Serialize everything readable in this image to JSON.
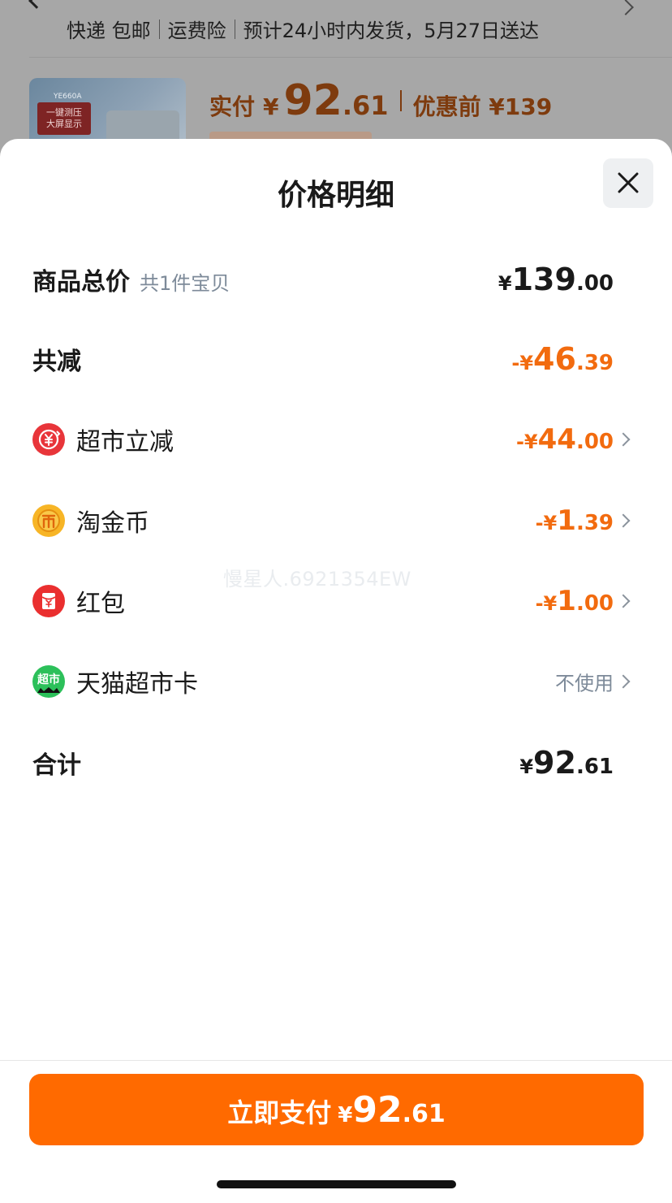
{
  "background": {
    "shipping": [
      "快递 包邮",
      "运费险",
      "预计24小时内发货，5月27日送达"
    ],
    "thumb_code": "YE660A",
    "thumb_badge": "一键测压 大屏显示",
    "paid_label": "实付",
    "paid_yen": "¥",
    "paid_int": "92",
    "paid_dec": ".61",
    "before_label": "优惠前 ¥139"
  },
  "sheet": {
    "title": "价格明细",
    "rows": [
      {
        "label": "商品总价",
        "sub": "共1件宝贝",
        "prefix": "¥",
        "int": "139",
        "dec": ".00"
      },
      {
        "label": "共减",
        "prefix": "-¥",
        "int": "46",
        "dec": ".39"
      },
      {
        "label": "超市立减",
        "icon": "yen-coupon-icon",
        "prefix": "-¥",
        "int": "44",
        "dec": ".00"
      },
      {
        "label": "淘金币",
        "icon": "gold-coin-icon",
        "prefix": "-¥",
        "int": "1",
        "dec": ".39"
      },
      {
        "label": "红包",
        "icon": "red-packet-icon",
        "prefix": "-¥",
        "int": "1",
        "dec": ".00"
      },
      {
        "label": "天猫超市卡",
        "icon": "tmall-supermarket-card-icon",
        "icon_text": "超市",
        "status": "不使用"
      },
      {
        "label": "合计",
        "prefix": "¥",
        "int": "92",
        "dec": ".61"
      }
    ],
    "watermark": "慢星人.6921354EW"
  },
  "footer": {
    "pay_label": "立即支付",
    "pay_yen": "¥",
    "pay_int": "92",
    "pay_dec": ".61"
  },
  "colors": {
    "accent": "#ff6a00",
    "discount": "#f26b0f",
    "text": "#1a1a1a",
    "muted": "#7d8a99"
  }
}
